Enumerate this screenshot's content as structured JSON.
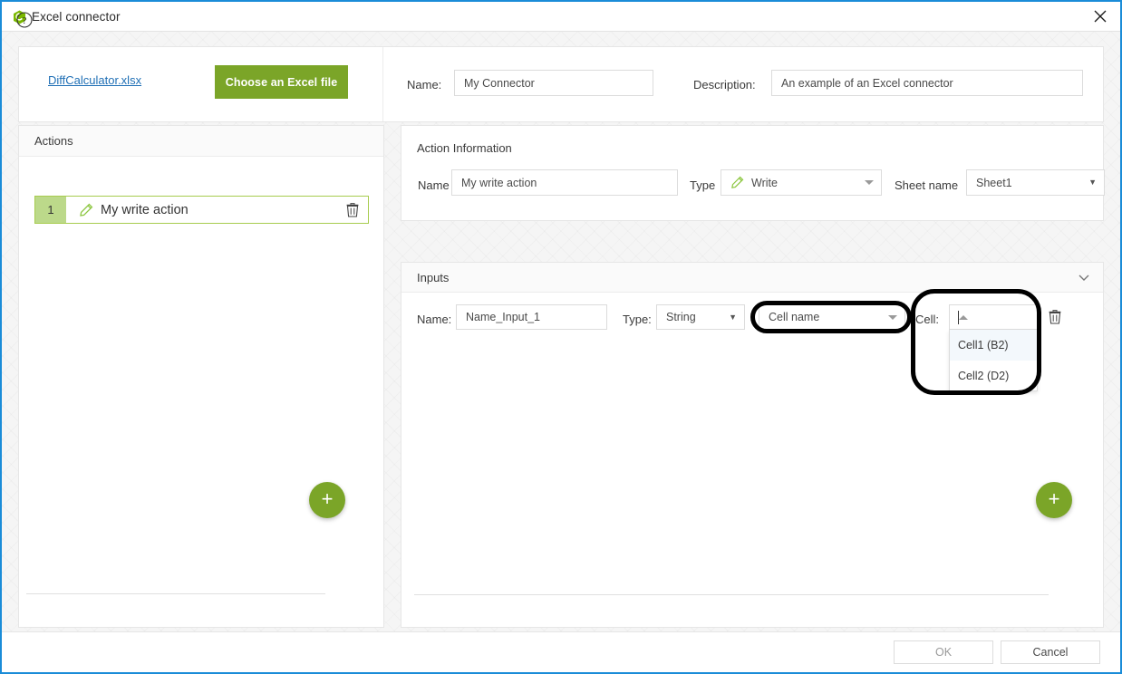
{
  "window": {
    "title": "Excel connector",
    "app_icon": "excel-connector-icon",
    "close_icon": "close-icon",
    "accent_green": "#7ba528",
    "accent_blue": "#1a8cd8"
  },
  "header": {
    "file_link": "DiffCalculator.xlsx",
    "choose_file_label": "Choose an Excel file",
    "name_label": "Name:",
    "name_value": "My Connector",
    "description_label": "Description:",
    "description_value": "An example of an Excel connector"
  },
  "actions_panel": {
    "title": "Actions",
    "add_icon": "plus-icon",
    "rows": [
      {
        "index": "1",
        "icon": "pencil-icon",
        "label": "My write action",
        "delete_icon": "trash-icon"
      }
    ]
  },
  "action_information": {
    "title": "Action Information",
    "name_label": "Name",
    "name_value": "My write action",
    "type_label": "Type",
    "type_value": "Write",
    "type_icon": "pencil-icon",
    "sheet_label": "Sheet name",
    "sheet_value": "Sheet1"
  },
  "inputs_panel": {
    "title": "Inputs",
    "collapse_icon": "chevron-down-icon",
    "add_icon": "plus-icon",
    "row": {
      "name_label": "Name:",
      "name_value": "Name_Input_1",
      "type_label": "Type:",
      "type_value": "String",
      "cellname_value": "Cell name",
      "cell_label": "Cell:",
      "cell_value": "",
      "delete_icon": "trash-icon",
      "dropdown_open": true,
      "dropdown_options": [
        {
          "label": "Cell1 (B2)",
          "hovered": true
        },
        {
          "label": "Cell2 (D2)",
          "hovered": false
        }
      ]
    }
  },
  "footer": {
    "help_icon": "help-icon",
    "ok_label": "OK",
    "cancel_label": "Cancel"
  }
}
